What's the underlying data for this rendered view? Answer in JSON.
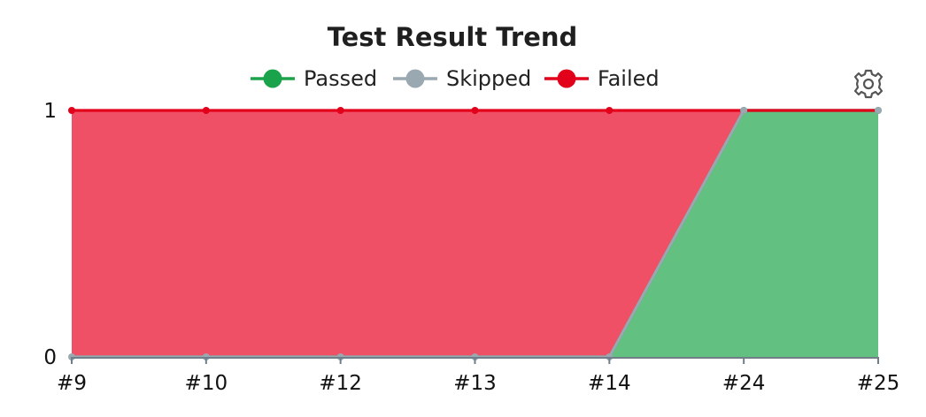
{
  "chart_data": {
    "type": "area",
    "title": "Test Result Trend",
    "categories": [
      "#9",
      "#10",
      "#12",
      "#13",
      "#14",
      "#24",
      "#25"
    ],
    "series": [
      {
        "name": "Passed",
        "color": "#1aa34a",
        "fill": "#62c081",
        "values": [
          0,
          0,
          0,
          0,
          0,
          1,
          1
        ]
      },
      {
        "name": "Skipped",
        "color": "#9aa8b1",
        "fill": "#9aa8b1",
        "values": [
          0,
          0,
          0,
          0,
          0,
          0,
          0
        ]
      },
      {
        "name": "Failed",
        "color": "#e2001a",
        "fill": "#ef5066",
        "values": [
          1,
          1,
          1,
          1,
          1,
          0,
          0
        ]
      }
    ],
    "stacked": true,
    "yticks": [
      0,
      1
    ],
    "ylim": [
      0,
      1
    ],
    "xlabel": "",
    "ylabel": "",
    "legend_position": "top",
    "grid": false
  },
  "toolbar": {
    "settings_icon": "gear-icon"
  }
}
